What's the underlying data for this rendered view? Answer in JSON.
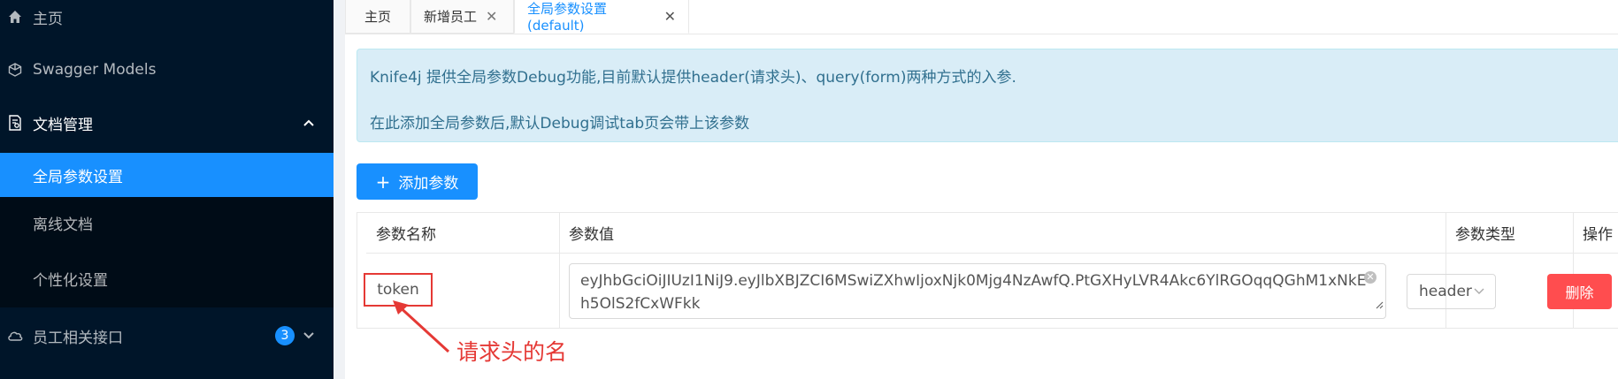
{
  "sidebar": {
    "items": [
      {
        "label": "主页"
      },
      {
        "label": "Swagger Models"
      },
      {
        "label": "文档管理"
      },
      {
        "label": "全局参数设置"
      },
      {
        "label": "离线文档"
      },
      {
        "label": "个性化设置"
      },
      {
        "label": "员工相关接口",
        "badge": "3"
      }
    ]
  },
  "tabs": [
    {
      "label": "主页"
    },
    {
      "label": "新增员工"
    },
    {
      "label": "全局参数设置(default)"
    }
  ],
  "alert": {
    "line1": "Knife4j 提供全局参数Debug功能,目前默认提供header(请求头)、query(form)两种方式的入参.",
    "line2": "在此添加全局参数后,默认Debug调试tab页会带上该参数"
  },
  "add_button": {
    "label": "添加参数"
  },
  "table": {
    "headers": [
      "参数名称",
      "参数值",
      "参数类型",
      "操作"
    ],
    "row": {
      "name": "token",
      "value": "eyJhbGciOiJIUzI1NiJ9.eyJlbXBJZCI6MSwiZXhwIjoxNjk0Mjg4NzAwfQ.PtGXHyLVR4Akc6YlRGOqqQGhM1xNkEh5OlS2fCxWFkk",
      "type": "header",
      "action": "删除"
    }
  },
  "annotation": {
    "text": "请求头的名"
  },
  "colors": {
    "sidebar_bg": "#001529",
    "accent": "#1890ff",
    "danger": "#ff4d4f",
    "annotation": "#e53935"
  }
}
